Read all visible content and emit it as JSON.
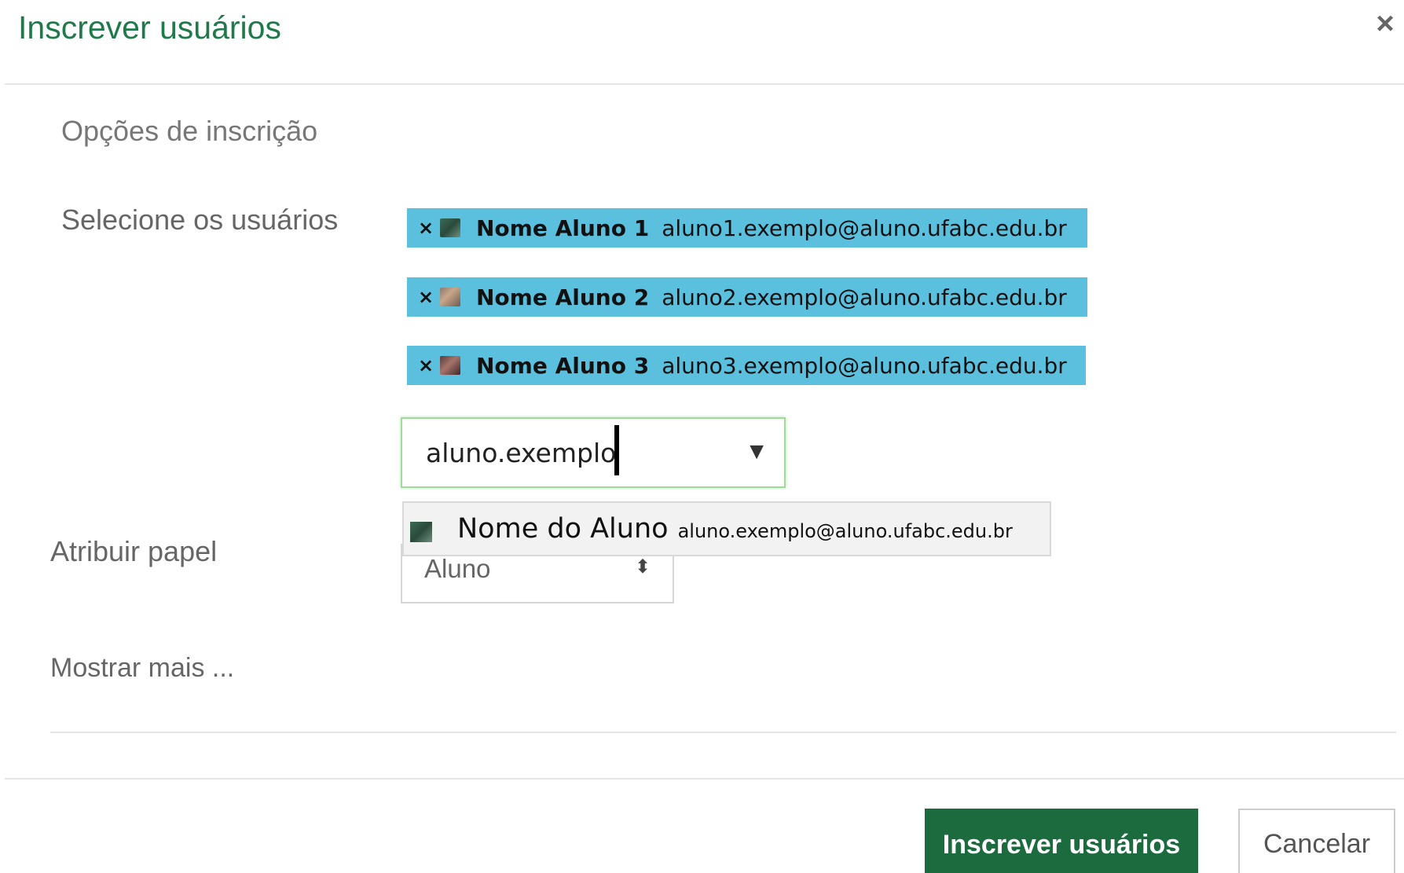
{
  "modal": {
    "title": "Inscrever usuários",
    "close_label": "×"
  },
  "section": {
    "title": "Opções de inscrição"
  },
  "select_users": {
    "label": "Selecione os usuários",
    "selected": [
      {
        "remove": "×",
        "name": "Nome Aluno 1",
        "email": "aluno1.exemplo@aluno.ufabc.edu.br"
      },
      {
        "remove": "×",
        "name": "Nome Aluno 2",
        "email": "aluno2.exemplo@aluno.ufabc.edu.br"
      },
      {
        "remove": "×",
        "name": "Nome Aluno 3",
        "email": "aluno3.exemplo@aluno.ufabc.edu.br"
      }
    ],
    "search_value": "aluno.exemplo",
    "dropdown_arrow": "▼",
    "suggestion": {
      "name": "Nome do Aluno",
      "email": "aluno.exemplo@aluno.ufabc.edu.br"
    }
  },
  "role": {
    "label": "Atribuir papel",
    "selected": "Aluno",
    "arrows": "⬍"
  },
  "show_more": "Mostrar mais ...",
  "footer": {
    "submit_label": "Inscrever usuários",
    "cancel_label": "Cancelar"
  },
  "colors": {
    "title_green": "#1f7a4a",
    "chip_blue": "#5bc0de",
    "primary_button": "#1b6b3f"
  }
}
